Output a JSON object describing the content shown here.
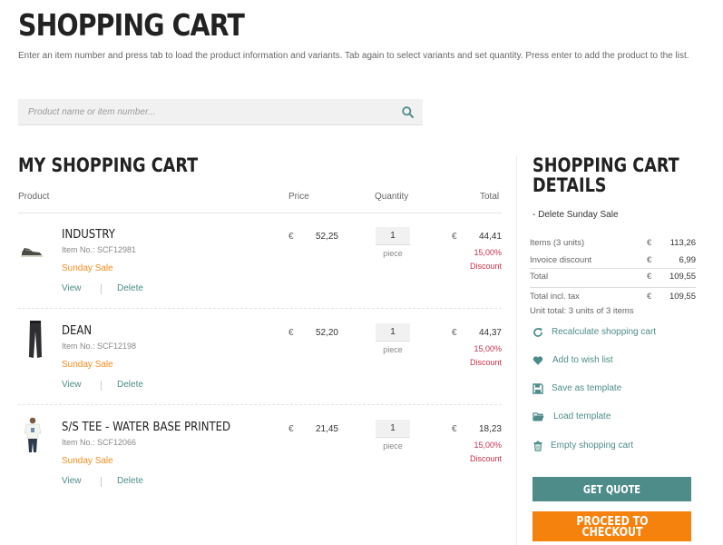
{
  "page": {
    "title": "SHOPPING CART",
    "intro": "Enter an item number and press tab to load the product information and variants. Tab again to select variants and set quantity. Press enter to add the product to the list."
  },
  "search": {
    "placeholder": "Product name or item number..."
  },
  "cart": {
    "title": "MY SHOPPING CART",
    "columns": {
      "product": "Product",
      "price": "Price",
      "quantity": "Quantity",
      "total": "Total"
    },
    "currency": "€",
    "items": [
      {
        "name": "INDUSTRY",
        "item_no": "Item No.: SCF12981",
        "promo": "Sunday Sale",
        "price": "52,25",
        "quantity": "1",
        "unit": "piece",
        "total": "44,41",
        "discount_pct": "15,00%",
        "discount_label": "Discount",
        "view": "View",
        "delete": "Delete",
        "image": "shoe"
      },
      {
        "name": "DEAN",
        "item_no": "Item No.: SCF12198",
        "promo": "Sunday Sale",
        "price": "52,20",
        "quantity": "1",
        "unit": "piece",
        "total": "44,37",
        "discount_pct": "15,00%",
        "discount_label": "Discount",
        "view": "View",
        "delete": "Delete",
        "image": "pants"
      },
      {
        "name": "S/S TEE - WATER BASE PRINTED",
        "item_no": "Item No.: SCF12066",
        "promo": "Sunday Sale",
        "price": "21,45",
        "quantity": "1",
        "unit": "piece",
        "total": "18,23",
        "discount_pct": "15,00%",
        "discount_label": "Discount",
        "view": "View",
        "delete": "Delete",
        "image": "tshirt"
      }
    ]
  },
  "details": {
    "title_line1": "SHOPPING CART",
    "title_line2": "DETAILS",
    "delete_sale": "- Delete Sunday Sale",
    "summary": [
      {
        "label": "Items (3 units)",
        "currency": "€",
        "value": "113,26"
      },
      {
        "label": "Invoice discount",
        "currency": "€",
        "value": "6,99"
      },
      {
        "label": "Total",
        "currency": "€",
        "value": "109,55"
      },
      {
        "label": "Total incl. tax",
        "currency": "€",
        "value": "109,55"
      }
    ],
    "unit_total": "Unit total: 3 units of 3 items",
    "actions": [
      {
        "label": "Recalculate shopping cart",
        "icon": "refresh-icon"
      },
      {
        "label": "Add to wish list",
        "icon": "heart-icon"
      },
      {
        "label": "Save as template",
        "icon": "floppy-icon"
      },
      {
        "label": "Load template",
        "icon": "folder-open-icon"
      },
      {
        "label": "Empty shopping cart",
        "icon": "trash-icon"
      }
    ],
    "quote_button": "GET QUOTE",
    "checkout_button": "PROCEED TO CHECKOUT"
  },
  "colors": {
    "accent": "#4e8c8a",
    "sale": "#f28c1e",
    "discount": "#c8324a",
    "checkout": "#f5820d"
  }
}
